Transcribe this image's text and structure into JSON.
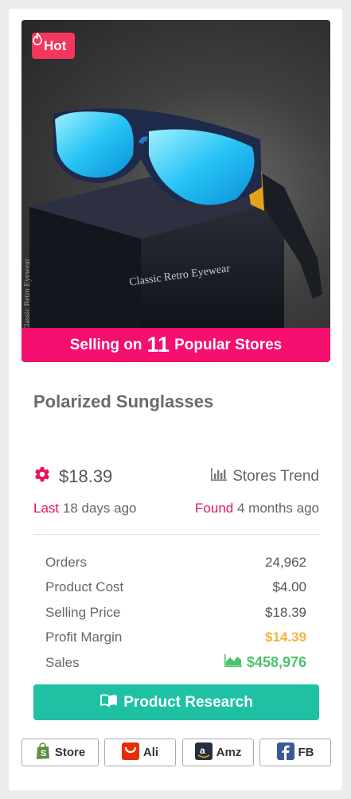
{
  "product": {
    "hot_label": "Hot",
    "banner_prefix": "Selling on",
    "banner_count": "11",
    "banner_suffix": "Popular Stores",
    "image_text_front": "Classic Retro Eyewear",
    "image_text_side": "Classic Retro Eyewear",
    "title": "Polarized Sunglasses",
    "price": "$18.39",
    "stores_trend_label": "Stores Trend",
    "last_label": "Last",
    "last_value": "18 days ago",
    "found_label": "Found",
    "found_value": "4 months ago"
  },
  "stats": {
    "orders_label": "Orders",
    "orders_value": "24,962",
    "cost_label": "Product Cost",
    "cost_value": "$4.00",
    "selling_label": "Selling Price",
    "selling_value": "$18.39",
    "margin_label": "Profit Margin",
    "margin_value": "$14.39",
    "sales_label": "Sales",
    "sales_value": "$458,976"
  },
  "actions": {
    "research_label": "Product Research",
    "store_label": "Store",
    "ali_label": "Ali",
    "amz_label": "Amz",
    "fb_label": "FB"
  },
  "icons": {
    "hot": "flame-icon",
    "price": "gear-icon",
    "trend": "bar-chart-icon",
    "sales": "area-chart-icon",
    "research": "book-icon",
    "store": "shopify-bag-icon",
    "ali": "aliexpress-icon",
    "amz": "amazon-icon",
    "fb": "facebook-icon"
  },
  "colors": {
    "hot": "#f2365c",
    "banner": "#f50f6f",
    "accent_pink": "#e6135e",
    "margin": "#f3b33d",
    "sales": "#4cc36c",
    "research_button": "#1ec1a4"
  }
}
